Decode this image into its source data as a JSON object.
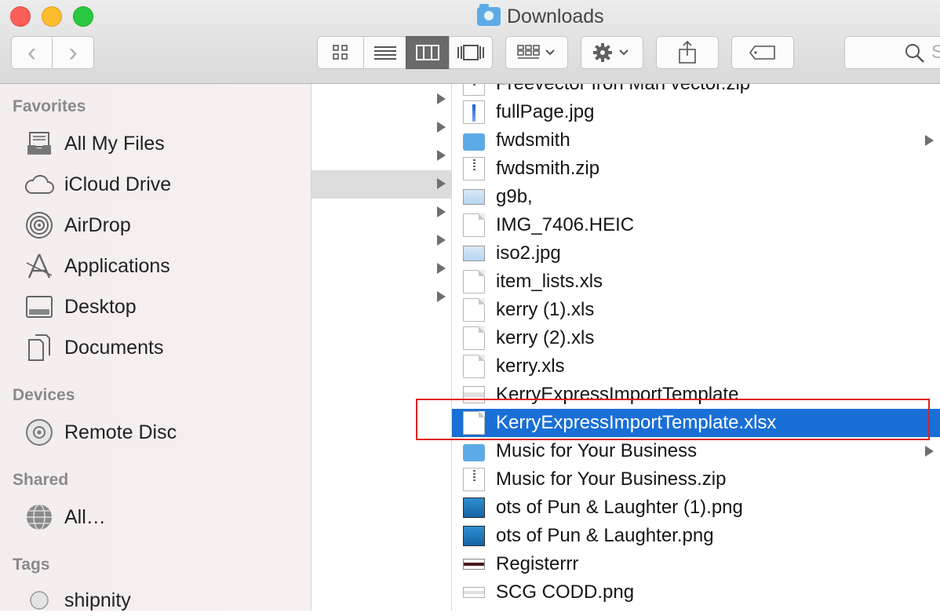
{
  "window": {
    "title": "Downloads"
  },
  "toolbar": {
    "back_glyph": "‹",
    "forward_glyph": "›",
    "view_icons": [
      "grid-view-icon",
      "list-view-icon",
      "column-view-icon",
      "coverflow-view-icon"
    ],
    "search_placeholder": "S"
  },
  "sidebar": {
    "sections": [
      {
        "title": "Favorites",
        "items": [
          {
            "label": "All My Files",
            "icon": "all-files-icon"
          },
          {
            "label": "iCloud Drive",
            "icon": "cloud-icon"
          },
          {
            "label": "AirDrop",
            "icon": "airdrop-icon"
          },
          {
            "label": "Applications",
            "icon": "applications-icon"
          },
          {
            "label": "Desktop",
            "icon": "desktop-icon"
          },
          {
            "label": "Documents",
            "icon": "documents-icon"
          }
        ]
      },
      {
        "title": "Devices",
        "items": [
          {
            "label": "Remote Disc",
            "icon": "disc-icon"
          }
        ]
      },
      {
        "title": "Shared",
        "items": [
          {
            "label": "All…",
            "icon": "network-icon"
          }
        ]
      },
      {
        "title": "Tags",
        "items": [
          {
            "label": "shipnity",
            "icon": "tag-circle-icon"
          }
        ]
      }
    ]
  },
  "files": [
    {
      "name": "Freevector Iron Man vector.zip",
      "kind": "zip"
    },
    {
      "name": "fullPage.jpg",
      "kind": "jpg"
    },
    {
      "name": "fwdsmith",
      "kind": "folder"
    },
    {
      "name": "fwdsmith.zip",
      "kind": "zip"
    },
    {
      "name": "g9b,",
      "kind": "image"
    },
    {
      "name": "IMG_7406.HEIC",
      "kind": "doc"
    },
    {
      "name": "iso2.jpg",
      "kind": "image"
    },
    {
      "name": "item_lists.xls",
      "kind": "doc"
    },
    {
      "name": "kerry (1).xls",
      "kind": "doc"
    },
    {
      "name": "kerry (2).xls",
      "kind": "doc"
    },
    {
      "name": "kerry.xls",
      "kind": "doc"
    },
    {
      "name": "KerryExpressImportTemplate",
      "kind": "sheet"
    },
    {
      "name": "KerryExpressImportTemplate.xlsx",
      "kind": "doc",
      "selected": true
    },
    {
      "name": "Music for Your Business",
      "kind": "folder"
    },
    {
      "name": "Music for Your Business.zip",
      "kind": "zip"
    },
    {
      "name": "ots of Pun & Laughter (1).png",
      "kind": "picture"
    },
    {
      "name": "ots of Pun & Laughter.png",
      "kind": "picture"
    },
    {
      "name": "Registerrr",
      "kind": "strip"
    },
    {
      "name": "SCG CODD.png",
      "kind": "thin"
    }
  ]
}
